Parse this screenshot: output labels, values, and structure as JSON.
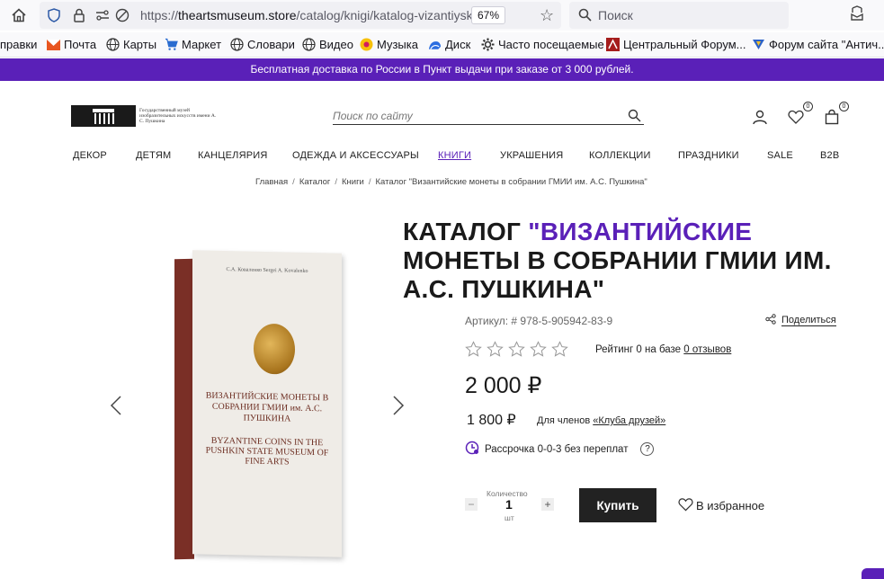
{
  "browser": {
    "url_prefix": "https://",
    "url_host": "theartsmuseum.store",
    "url_path": "/catalog/knigi/katalog-vizantiyskie-",
    "zoom": "67%",
    "search_placeholder": "Поиск",
    "bookmarks": [
      {
        "label": "правки",
        "icon": "none"
      },
      {
        "label": "Почта",
        "icon": "mail-icon"
      },
      {
        "label": "Карты",
        "icon": "globe-icon"
      },
      {
        "label": "Маркет",
        "icon": "cart-icon"
      },
      {
        "label": "Словари",
        "icon": "globe-icon"
      },
      {
        "label": "Видео",
        "icon": "globe-icon"
      },
      {
        "label": "Музыка",
        "icon": "music-icon"
      },
      {
        "label": "Диск",
        "icon": "disk-icon"
      },
      {
        "label": "Часто посещаемые",
        "icon": "gear-icon"
      },
      {
        "label": "Центральный Форум...",
        "icon": "forum-icon"
      },
      {
        "label": "Форум сайта \"Антич...",
        "icon": "forum-icon"
      }
    ]
  },
  "promo": {
    "text": "Бесплатная доставка по России в Пункт выдачи при заказе от 3 000 рублей."
  },
  "header": {
    "logo_text": "Государственный музей изобразительных искусств имени А. С. Пушкина",
    "search_placeholder": "Поиск по сайту",
    "wishlist_count": "0",
    "cart_count": "0"
  },
  "nav": [
    {
      "label": "ДЕКОР",
      "active": false
    },
    {
      "label": "ДЕТЯМ",
      "active": false
    },
    {
      "label": "КАНЦЕЛЯРИЯ",
      "active": false
    },
    {
      "label": "ОДЕЖДА И АКСЕССУАРЫ",
      "active": false
    },
    {
      "label": "КНИГИ",
      "active": true
    },
    {
      "label": "УКРАШЕНИЯ",
      "active": false
    },
    {
      "label": "КОЛЛЕКЦИИ",
      "active": false
    },
    {
      "label": "ПРАЗДНИКИ",
      "active": false
    },
    {
      "label": "SALE",
      "active": false
    },
    {
      "label": "B2B",
      "active": false
    }
  ],
  "breadcrumb": [
    "Главная",
    "Каталог",
    "Книги",
    "Каталог \"Византийские монеты в собрании ГМИИ им. А.С. Пушкина\""
  ],
  "product": {
    "title_prefix": "КАТАЛОГ ",
    "title_highlight": "\"ВИЗАНТИЙСКИЕ",
    "title_rest": " МОНЕТЫ В СОБРАНИИ ГМИИ ИМ. А.С. ПУШКИНА\"",
    "sku": "Артикул: # 978-5-905942-83-9",
    "share_label": "Поделиться",
    "rating_stars": 0,
    "rating_max": 5,
    "rating_text": "Рейтинг 0 на базе ",
    "reviews_link": "0 отзывов",
    "price": "2 000 ₽",
    "member_price": "1 800 ₽",
    "member_note": "Для членов ",
    "member_link": "«Клуба друзей»",
    "installment": "Рассрочка 0-0-3 без переплат",
    "installment_help": "?",
    "qty_label": "Количество",
    "qty_value": "1",
    "qty_unit": "шт",
    "qty_minus": "−",
    "qty_plus": "+",
    "buy_label": "Купить",
    "favorite_label": "В избранное",
    "book": {
      "authors": "С.А. Коваленко  Sergei A. Kovalenko",
      "title_ru": "ВИЗАНТИЙСКИЕ МОНЕТЫ В СОБРАНИИ ГМИИ им. А.С. ПУШКИНА",
      "title_en": "BYZANTINE COINS IN THE PUSHKIN STATE MUSEUM OF FINE ARTS"
    }
  },
  "colors": {
    "accent": "#5a20b8",
    "buy_button": "#222222"
  }
}
